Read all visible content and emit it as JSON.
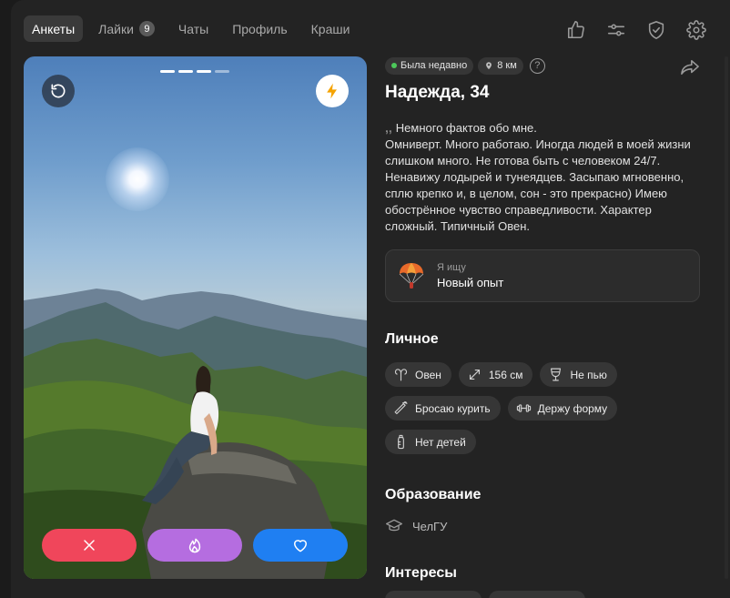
{
  "nav": {
    "tabs": [
      {
        "label": "Анкеты",
        "active": true
      },
      {
        "label": "Лайки",
        "badge": "9"
      },
      {
        "label": "Чаты"
      },
      {
        "label": "Профиль"
      },
      {
        "label": "Краши"
      }
    ],
    "icons": [
      "thumbs-up-icon",
      "sliders-icon",
      "shield-check-icon",
      "gear-icon"
    ]
  },
  "photo": {
    "progress_total": 4,
    "progress_active": 3
  },
  "profile": {
    "status": "Была недавно",
    "distance": "8 км",
    "help": "?",
    "name": "Надежда, 34",
    "bio_quote": "‚‚",
    "bio_lines": [
      "Немного фактов обо мне.",
      "Омниверт. Много работаю. Иногда людей в моей жизни слишком много. Не готова быть с человеком 24/7. Ненавижу лодырей и тунеядцев. Засыпаю мгновенно, сплю крепко и, в целом, сон - это прекрасно) Имею обострённое чувство справедливости. Характер сложный. Типичный Овен."
    ],
    "looking_for": {
      "label": "Я ищу",
      "value": "Новый опыт"
    }
  },
  "personal": {
    "title": "Личное",
    "items": [
      {
        "label": "Овен",
        "icon": "aries-icon"
      },
      {
        "label": "156 см",
        "icon": "height-arrows-icon"
      },
      {
        "label": "Не пью",
        "icon": "wine-glass-icon"
      },
      {
        "label": "Бросаю курить",
        "icon": "cigarette-icon"
      },
      {
        "label": "Держу форму",
        "icon": "dumbbell-icon"
      },
      {
        "label": "Нет детей",
        "icon": "baby-bottle-icon"
      }
    ]
  },
  "education": {
    "title": "Образование",
    "value": "ЧелГУ"
  },
  "interests": {
    "title": "Интересы"
  },
  "colors": {
    "background": "#1b1b1b",
    "panel": "#232323",
    "chip": "#363636",
    "dislike": "#f0465b",
    "super": "#b56de0",
    "like": "#1f7ff2",
    "online": "#4cc85a"
  }
}
